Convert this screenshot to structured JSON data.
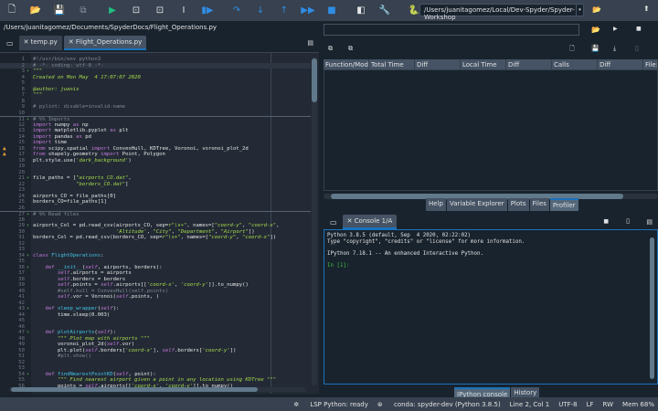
{
  "toolbar": {
    "buttons": [
      {
        "name": "new-file-icon",
        "glyph": "🗋",
        "cls": ""
      },
      {
        "name": "open-folder-icon",
        "glyph": "📂",
        "cls": ""
      },
      {
        "name": "save-icon",
        "glyph": "💾",
        "cls": "gray"
      },
      {
        "name": "save-all-icon",
        "glyph": "⧉",
        "cls": "gray"
      },
      {
        "name": "run-icon",
        "glyph": "▶",
        "cls": "green"
      },
      {
        "name": "run-cell-icon",
        "glyph": "⊡",
        "cls": ""
      },
      {
        "name": "run-cell-advance-icon",
        "glyph": "⊡",
        "cls": ""
      },
      {
        "name": "run-selection-icon",
        "glyph": "I",
        "cls": ""
      },
      {
        "name": "debug-icon",
        "glyph": "▮▶",
        "cls": "blue"
      },
      {
        "name": "step-over-icon",
        "glyph": "↷",
        "cls": "blue"
      },
      {
        "name": "step-into-icon",
        "glyph": "↓",
        "cls": "blue"
      },
      {
        "name": "step-return-icon",
        "glyph": "↑",
        "cls": "blue"
      },
      {
        "name": "continue-icon",
        "glyph": "▶▶",
        "cls": "blue"
      },
      {
        "name": "stop-debug-icon",
        "glyph": "■",
        "cls": "blue"
      },
      {
        "name": "maximize-pane-icon",
        "glyph": "◧",
        "cls": ""
      },
      {
        "name": "preferences-wrench-icon",
        "glyph": "🔧",
        "cls": ""
      },
      {
        "name": "python-path-icon",
        "glyph": "🐍",
        "cls": ""
      }
    ],
    "working_directory": "/Users/juanitagomez/Local/Dev-Spyder/Spyder-Workshop"
  },
  "editor": {
    "path": "/Users/juanitagomez/Documents/SpyderDocs/Flight_Operations.py",
    "tabs": [
      {
        "label": "temp.py",
        "active": false
      },
      {
        "label": "Flight_Operations.py",
        "active": true
      }
    ],
    "current_line": 2,
    "warning_lines": [
      16,
      17
    ],
    "fold_lines": [
      3,
      11,
      21,
      27,
      29,
      34,
      36,
      43,
      47,
      54
    ],
    "cell_lines": [
      11,
      27
    ],
    "lines": [
      "#!/usr/bin/env python3",
      "# -*- coding: utf-8 -*-",
      "\"\"\"",
      "Created on Mon May  4 17:07:07 2020",
      "",
      "@author: juanis",
      "\"\"\"",
      "",
      "# pylint: disable=invalid-name",
      "",
      "# %% Imports",
      "import numpy as np",
      "import matplotlib.pyplot as plt",
      "import pandas as pd",
      "import time",
      "from scipy.spatial import ConvexHull, KDTree, Voronoi, voronoi_plot_2d",
      "from shapely.geometry import Point, Polygon",
      "plt.style.use('dark_background')",
      "",
      "",
      "file_paths = [\"airports_CO.dat\",",
      "              \"borders_CO.dat\"]",
      "",
      "airports_CO = file_paths[0]",
      "borders_CO=file_paths[1]",
      "",
      "# %% Read files",
      "",
      "airports_Col = pd.read_csv(airports_CO, sep=r\"\\s+\", names=[\"coord-y\", \"coord-x\",",
      "                           'Altitude', \"City\", \"Department\", \"Airport\"])",
      "borders_Col = pd.read_csv(borders_CO, sep=r\"\\s+\", names=[\"coord-y\", \"coord-x\"])",
      "",
      "",
      "class FlightOperations:",
      "",
      "    def __init__(self, airports, borders):",
      "        self.airports = airports",
      "        self.borders = borders",
      "        self.points = self.airports[['coord-x', 'coord-y']].to_numpy()",
      "        #self.hull = ConvexHull(self.points)",
      "        self.vor = Voronoi(self.points, )",
      "",
      "    def sleep_wrapper(self):",
      "        time.sleep(0.003)",
      "",
      "",
      "    def plotAirports(self):",
      "        \"\"\" Plot map with airports \"\"\"",
      "        voronoi_plot_2d(self.vor)",
      "        plt.plot(self.borders['coord-x'], self.borders['coord-y'])",
      "        #plt.show()",
      "",
      "",
      "    def findNearestPointKD(self, point):",
      "        \"\"\" Find nearest airport given a point in any location using KDTree \"\"\"",
      "        points = self.airports[['coord-x', 'coord-y']].to_numpy()"
    ]
  },
  "profiler": {
    "columns": [
      "Function/Module",
      "Total Time",
      "Diff",
      "Local Time",
      "Diff",
      "Calls",
      "Diff",
      "File:"
    ]
  },
  "top_tabs": [
    "Help",
    "Variable Explorer",
    "Plots",
    "Files",
    "Profiler"
  ],
  "top_tabs_active": "Profiler",
  "console": {
    "tab": "Console 1/A",
    "output": [
      "Python 3.8.5 (default, Sep  4 2020, 02:22:02)",
      "Type \"copyright\", \"credits\" or \"license\" for more information.",
      "",
      "IPython 7.18.1 -- An enhanced Interactive Python.",
      ""
    ],
    "prompt": "In [1]:"
  },
  "bottom_tabs": [
    "IPython console",
    "History"
  ],
  "bottom_tabs_active": "IPython console",
  "status": {
    "lsp": "LSP Python: ready",
    "env": "conda: spyder-dev (Python 3.8.5)",
    "position": "Line 2, Col 1",
    "encoding": "UTF-8",
    "eol": "LF",
    "permissions": "RW",
    "memory": "Mem 68%"
  }
}
